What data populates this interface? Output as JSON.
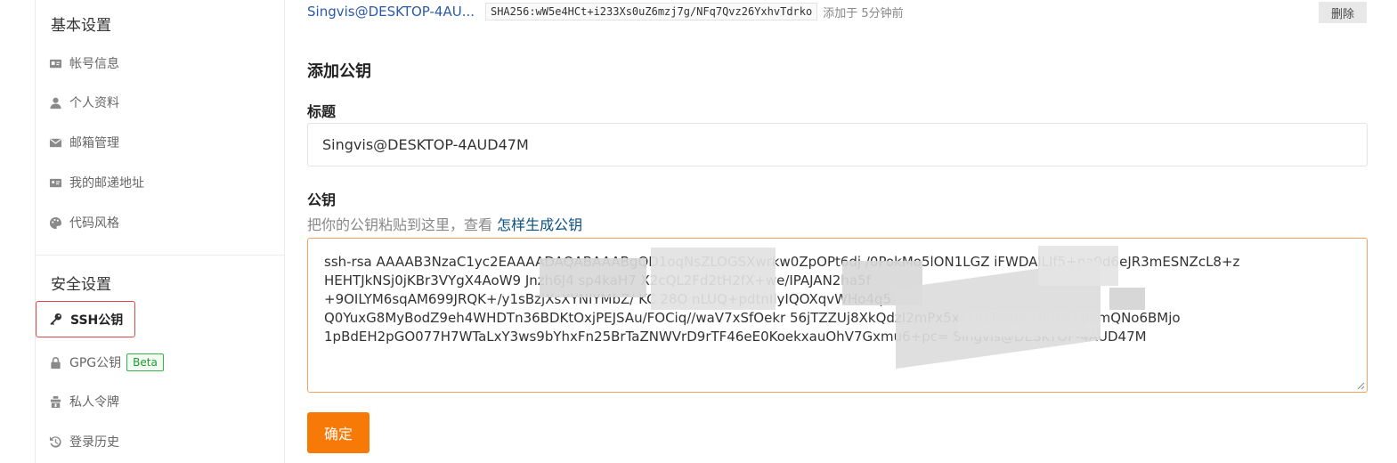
{
  "sidebar": {
    "basic_title": "基本设置",
    "basic_items": [
      {
        "label": "帐号信息",
        "icon": "id-card-icon"
      },
      {
        "label": "个人资料",
        "icon": "user-icon"
      },
      {
        "label": "邮箱管理",
        "icon": "mail-icon"
      },
      {
        "label": "我的邮递地址",
        "icon": "address-card-icon"
      },
      {
        "label": "代码风格",
        "icon": "palette-icon"
      }
    ],
    "security_title": "安全设置",
    "security_items": [
      {
        "label": "SSH公钥",
        "icon": "key-icon",
        "active": true
      },
      {
        "label": "GPG公钥",
        "icon": "lock-icon",
        "badge": "Beta"
      },
      {
        "label": "私人令牌",
        "icon": "token-icon"
      },
      {
        "label": "登录历史",
        "icon": "history-icon"
      }
    ]
  },
  "existing_key": {
    "title": "Singvis@DESKTOP-4AU...",
    "fingerprint": "SHA256:wW5e4HCt+i233Xs0uZ6mzj7g/NFq7Qvz26YxhvTdrko",
    "added": "添加于 5分钟前",
    "delete_label": "删除"
  },
  "form": {
    "heading": "添加公钥",
    "title_label": "标题",
    "title_value": "Singvis@DESKTOP-4AUD47M",
    "key_label": "公钥",
    "hint_text": "把你的公钥粘贴到这里，查看 ",
    "hint_link": "怎样生成公钥",
    "key_lines": [
      "ssh-rsa AAAAB3NzaC1yc2EAAAADAQABAAABgQD1oqNsZLOGSXwrkw0ZpOPt6dj          /0PokMo5lON1LGZ          iFWDAlLIf5+pa9d6eJR3mESNZcL8+z",
      "HEHTJkNSj0jKBr3VYgX4AoW9                      Jnzh6J4                              sp4kaH7                X2cQL2Fd2tH2fX+we/IPAJAN2ha5f",
      "+9OILYM6sqAM699JRQK+/y1sBzjXsXYNIYMbZ/                    KC                                       28O               nLUQ+pdtnIlyIQOXqvWHo4q5",
      "Q0YuxG8MyBodZ9eh4WHDTn36BDKtOxjPEJSAu/FOCiq//waV7xSfOekr                                    56jTZZUj8XkQdzI2mPx5xFkozTeNpL10RhFKpamQNo6BMjo",
      "1pBdEH2pGO077H7WTaLxY3ws9bYhxFn25BrTaZNWVrD9rTF46eE0KoekxauOhV7Gxmu6+pc= Singvis@DESKTOP-4AUD47M"
    ],
    "confirm_label": "确定"
  },
  "colors": {
    "accent": "#f77a08",
    "link": "#0a4f7f",
    "active_border": "#e0474b",
    "badge_green": "#1e9b33"
  }
}
